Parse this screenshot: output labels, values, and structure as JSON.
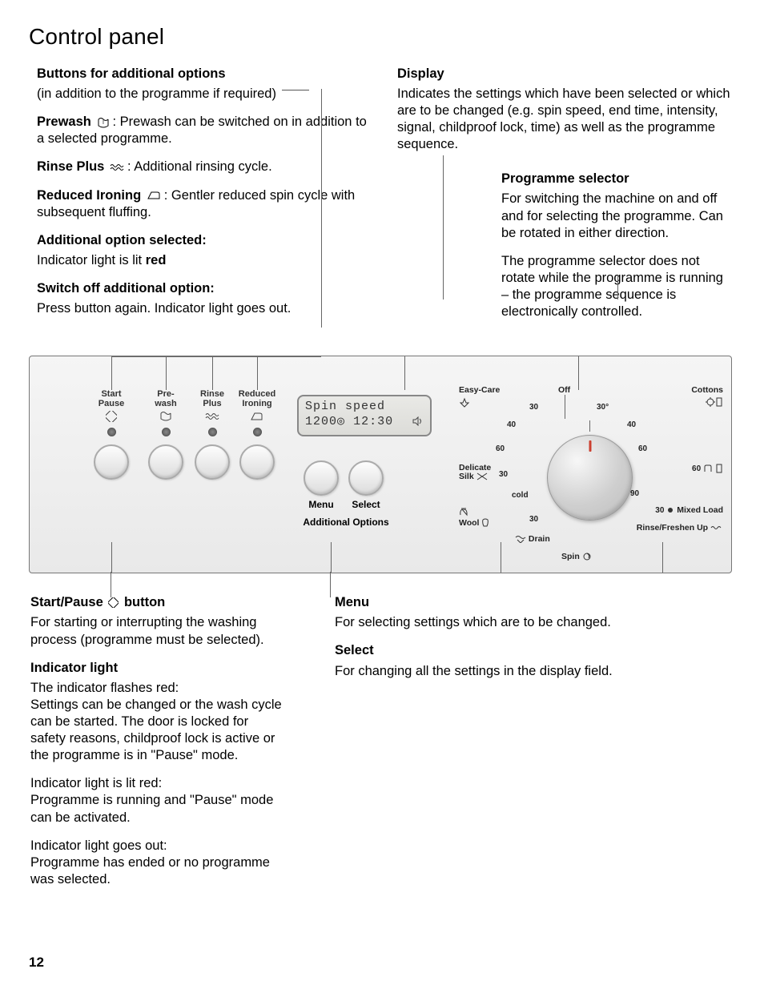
{
  "title": "Control panel",
  "page_number": "12",
  "buttons_section": {
    "heading": "Buttons for additional options",
    "subhead": "(in addition to the programme if required)",
    "prewash": {
      "label": "Prewash",
      "after": ": Prewash can be switched on in addition to a selected programme."
    },
    "rinseplus": {
      "label": "Rinse Plus",
      "after": ": Additional rinsing cycle."
    },
    "reduced": {
      "label": "Reduced Ironing",
      "after": ": Gentler reduced spin cycle with subsequent fluffing."
    },
    "selected_h": "Additional option selected:",
    "selected_t": "Indicator light is lit ",
    "selected_red": "red",
    "switchoff_h": "Switch off additional option:",
    "switchoff_t": "Press button again. Indicator light goes out."
  },
  "display_section": {
    "heading": "Display",
    "body": "Indicates the settings which have been selected or which are to be changed (e.g. spin speed, end time, intensity, signal, childproof lock, time) as well as the programme sequence."
  },
  "selector_section": {
    "heading": "Programme selector",
    "p1": "For switching the machine on and off and for selecting the programme. Can be rotated in either direction.",
    "p2": "The programme selector does not rotate while the programme is running – the programme sequence is electronically controlled."
  },
  "panel": {
    "buttons": {
      "start_pause": {
        "l1": "Start",
        "l2": "Pause"
      },
      "prewash": {
        "l1": "Pre-",
        "l2": "wash"
      },
      "rinse_plus": {
        "l1": "Rinse",
        "l2": "Plus"
      },
      "reduced": {
        "l1": "Reduced",
        "l2": "Ironing"
      },
      "menu": "Menu",
      "select": "Select",
      "add_opts": "Additional Options"
    },
    "display": {
      "line1": "Spin speed",
      "line2_left": "1200",
      "line2_mid": "12:30"
    },
    "dial": {
      "top_left": "Easy-Care",
      "top_right": "Cottons",
      "off": "Off",
      "left_delicate": "Delicate",
      "left_silk": "Silk",
      "left_wool": "Wool",
      "left_drain": "Drain",
      "bottom_spin": "Spin",
      "right_mixed": "Mixed Load",
      "right_refresh": "Rinse/Freshen Up",
      "temps_left": [
        "30",
        "40",
        "60",
        "30",
        "cold",
        "30"
      ],
      "temps_top": "30",
      "temps_right": [
        "30°",
        "40",
        "60",
        "60",
        "90",
        "30"
      ]
    }
  },
  "lower": {
    "startpause_h_pre": "Start/Pause ",
    "startpause_h_post": " button",
    "startpause_t": "For starting or interrupting the washing process (programme must be selected).",
    "indic_h": "Indicator light",
    "indic_p1": "The indicator flashes red:\nSettings can be changed or the wash cycle can be started. The door is locked for safety reasons, childproof lock is active or the programme is in \"Pause\" mode.",
    "indic_p2": "Indicator light is lit red:\nProgramme is running and \"Pause\" mode can be activated.",
    "indic_p3": "Indicator light goes out:\nProgramme has ended or no programme was selected.",
    "menu_h": "Menu",
    "menu_t": "For selecting settings which are to be changed.",
    "select_h": "Select",
    "select_t": "For changing all the settings in the display field."
  }
}
